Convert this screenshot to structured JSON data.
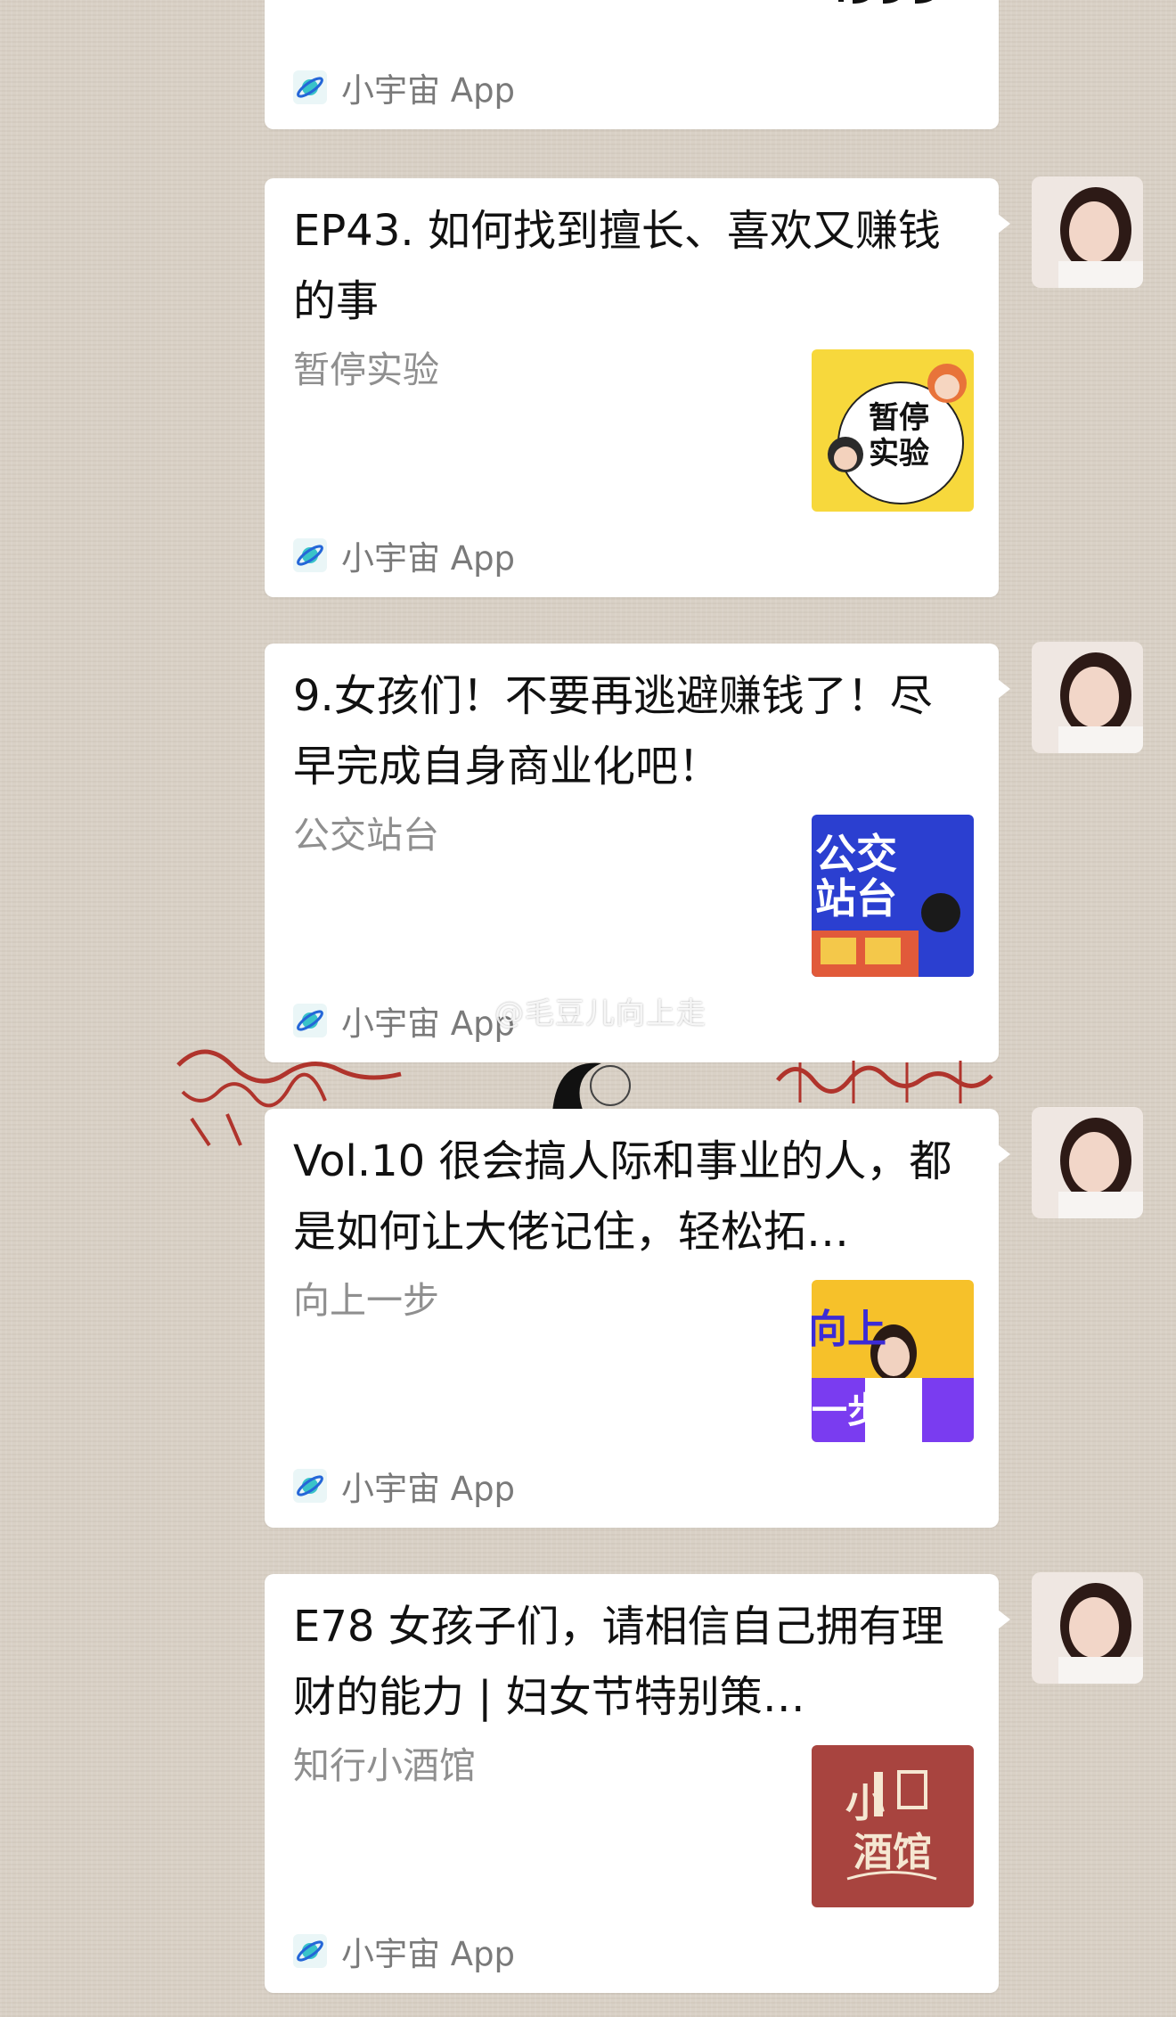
{
  "messages": [
    {
      "partial": true,
      "source": "小宇宙 App"
    },
    {
      "title": "EP43. 如何找到擅长、喜欢又赚钱的事",
      "podcast": "暂停实验",
      "source": "小宇宙 App",
      "cover": {
        "text1": "暂停",
        "text2": "实验",
        "bg": "#f7d83c"
      }
    },
    {
      "title": "9.女孩们！不要再逃避赚钱了！尽早完成自身商业化吧！",
      "podcast": "公交站台",
      "source": "小宇宙 App",
      "cover": {
        "text1": "公交",
        "text2": "站台",
        "bg": "#2b3fd0"
      }
    },
    {
      "title": "Vol.10 很会搞人际和事业的人，都是如何让大佬记住，轻松拓…",
      "podcast": "向上一步",
      "source": "小宇宙 App",
      "cover": {
        "text1": "向上",
        "text2": "一步",
        "bg": "#7a3cf0"
      }
    },
    {
      "title": "E78 女孩子们，请相信自己拥有理财的能力 | 妇女节特别策…",
      "podcast": "知行小酒馆",
      "source": "小宇宙 App",
      "cover": {
        "text1": "小",
        "text2": "酒馆",
        "bg": "#a8443f"
      }
    }
  ],
  "watermark": "@毛豆儿向上走",
  "colors": {
    "bubble": "#ffffff",
    "background": "#d9d1c6",
    "title": "#111111",
    "subtitle": "#8f8f8f",
    "source": "#7a7a7a"
  }
}
